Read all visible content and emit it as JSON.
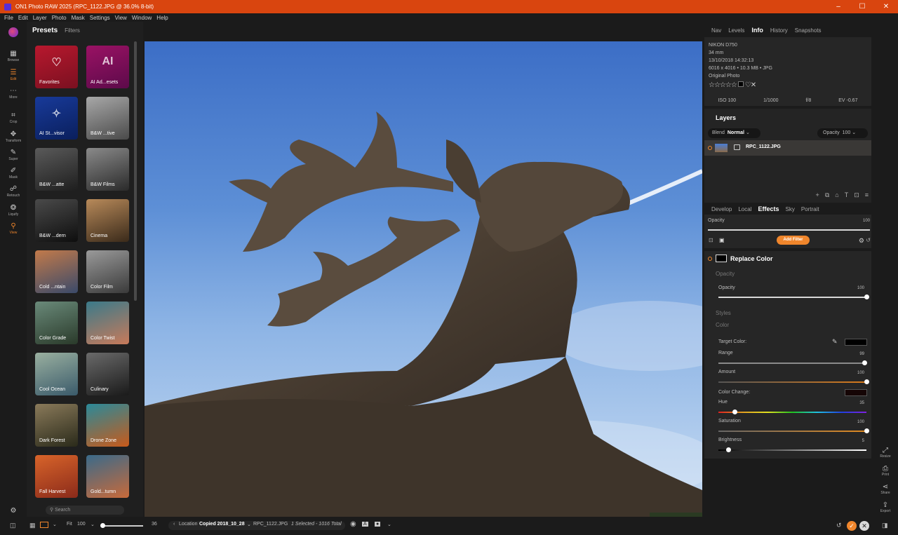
{
  "window": {
    "title": "ON1 Photo RAW 2025 (RPC_1122.JPG @ 36.0% 8-bit)",
    "minimize": "–",
    "maximize": "☐",
    "close": "✕"
  },
  "menu": [
    "File",
    "Edit",
    "Layer",
    "Photo",
    "Mask",
    "Settings",
    "View",
    "Window",
    "Help"
  ],
  "left_tools": [
    {
      "label": "Browse",
      "icon": "▦"
    },
    {
      "label": "Edit",
      "icon": "☰"
    },
    {
      "label": "More",
      "icon": "⋯"
    },
    {
      "label": "Crop",
      "icon": "⌗"
    },
    {
      "label": "Transform",
      "icon": "✥"
    },
    {
      "label": "Super",
      "icon": "✎"
    },
    {
      "label": "Mask",
      "icon": "✐"
    },
    {
      "label": "Retouch",
      "icon": "☍"
    },
    {
      "label": "Liquify",
      "icon": "❂"
    },
    {
      "label": "View",
      "icon": "⚲"
    }
  ],
  "presets": {
    "tab_active": "Presets",
    "tab_other": "Filters",
    "search_placeholder": "Search",
    "tiles": [
      {
        "label": "Favorites",
        "color_a": "#7a1020",
        "color_b": "#b8182e",
        "icon": "♡"
      },
      {
        "label": "AI Ad...esets",
        "color_a": "#5c0a4a",
        "color_b": "#9a1264",
        "icon": "AI"
      },
      {
        "label": "AI St...visor",
        "color_a": "#0a1f5c",
        "color_b": "#183a9a",
        "icon": "✧"
      },
      {
        "label": "B&W ...tive",
        "color_a": "#4a4a4a",
        "color_b": "#a8a8a8",
        "icon": ""
      },
      {
        "label": "B&W ...atte",
        "color_a": "#1e1e1e",
        "color_b": "#5a5a5a",
        "icon": ""
      },
      {
        "label": "B&W Films",
        "color_a": "#2a2a2a",
        "color_b": "#8a8a8a",
        "icon": ""
      },
      {
        "label": "B&W ...dern",
        "color_a": "#0e0e0e",
        "color_b": "#4a4a4a",
        "icon": ""
      },
      {
        "label": "Cinema",
        "color_a": "#3a2a1a",
        "color_b": "#b88a5a",
        "icon": ""
      },
      {
        "label": "Cold ...ntain",
        "color_a": "#3a4a6a",
        "color_b": "#c27a4a",
        "icon": ""
      },
      {
        "label": "Color Film",
        "color_a": "#3a3a3a",
        "color_b": "#9a9a9a",
        "icon": ""
      },
      {
        "label": "Color Grade",
        "color_a": "#2a3a2a",
        "color_b": "#6a8a7a",
        "icon": ""
      },
      {
        "label": "Color Twist",
        "color_a": "#c87a5a",
        "color_b": "#3a7a8a",
        "icon": ""
      },
      {
        "label": "Cool Ocean",
        "color_a": "#3a5a6a",
        "color_b": "#9ab0a0",
        "icon": ""
      },
      {
        "label": "Culinary",
        "color_a": "#1a1a1a",
        "color_b": "#6a6a6a",
        "icon": ""
      },
      {
        "label": "Dark Forest",
        "color_a": "#2a2a1a",
        "color_b": "#8a7a5a",
        "icon": ""
      },
      {
        "label": "Drone Zone",
        "color_a": "#c85a1a",
        "color_b": "#2a8a9a",
        "icon": ""
      },
      {
        "label": "Fall Harvest",
        "color_a": "#8a2a1a",
        "color_b": "#d8642a",
        "icon": ""
      },
      {
        "label": "Gold...tumn",
        "color_a": "#c86a3a",
        "color_b": "#3a6a8a",
        "icon": ""
      }
    ]
  },
  "right_tabs": [
    "Nav",
    "Levels",
    "Info",
    "History",
    "Snapshots"
  ],
  "right_tab_active": "Info",
  "info": {
    "camera": "NIKON D750",
    "focal": "34 mm",
    "datetime": "13/10/2018 14:32:13",
    "dims": "6016 x 4016 • 10.3 MB • JPG",
    "kind": "Original Photo",
    "stars": "☆☆☆☆☆",
    "heart": "♡",
    "reject": "✕",
    "iso": "ISO 100",
    "shutter": "1/1000",
    "aperture": "f/8",
    "ev": "EV -0.67"
  },
  "layers": {
    "title": "Layers",
    "blend_label": "Blend",
    "blend_value": "Normal",
    "opacity_label": "Opacity",
    "opacity_value": "100",
    "layer_name": "RPC_1122.JPG",
    "tools": [
      "+",
      "⧉",
      "⌂",
      "T",
      "⊡",
      "≡"
    ]
  },
  "effects_tabs": [
    "Develop",
    "Local",
    "Effects",
    "Sky",
    "Portrait"
  ],
  "effects_tab_active": "Effects",
  "effects": {
    "opacity_label": "Opacity",
    "opacity_value": "100",
    "add_filter": "Add Filter"
  },
  "filter": {
    "name": "Replace Color",
    "section_opacity": "Opacity",
    "opacity_label": "Opacity",
    "opacity_value": "100",
    "opacity_fraction": 1.0,
    "section_styles": "Styles",
    "section_color": "Color",
    "target_color_label": "Target Color:",
    "range_label": "Range",
    "range_value": "99",
    "range_fraction": 0.99,
    "amount_label": "Amount",
    "amount_value": "100",
    "amount_fraction": 1.0,
    "color_change_label": "Color Change:",
    "hue_label": "Hue",
    "hue_value": "35",
    "hue_fraction": 0.11,
    "saturation_label": "Saturation",
    "saturation_value": "100",
    "saturation_fraction": 1.0,
    "brightness_label": "Brightness",
    "brightness_value": "5",
    "brightness_fraction": 0.07
  },
  "right_tools": [
    {
      "label": "Resize",
      "icon": "⤢"
    },
    {
      "label": "Print",
      "icon": "⎙"
    },
    {
      "label": "Share",
      "icon": "⋖"
    },
    {
      "label": "Export",
      "icon": "⇪"
    }
  ],
  "bottom": {
    "fit": "Fit",
    "zoom": "100",
    "slider_value": "36",
    "location_label": "Location",
    "location_value": "Copied 2018_10_28",
    "filename": "RPC_1122.JPG",
    "selection": "1 Selected - 1016 Total"
  },
  "colors": {
    "accent": "#f0862c",
    "titlebar": "#d9450f"
  }
}
